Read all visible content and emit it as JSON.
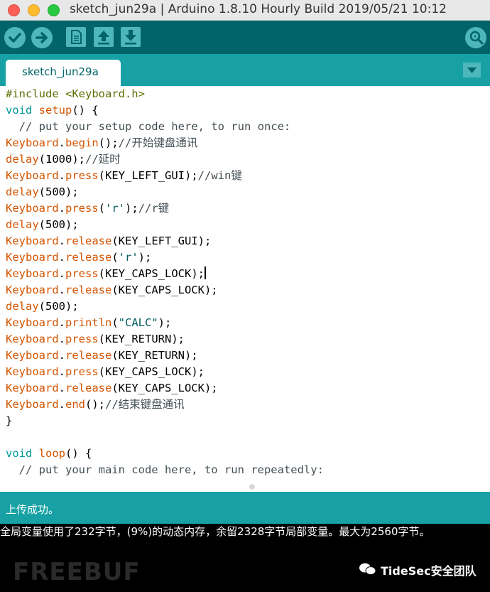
{
  "window": {
    "title": "sketch_jun29a | Arduino 1.8.10 Hourly Build 2019/05/21 10:12"
  },
  "toolbar": {
    "icons": [
      "verify-icon",
      "upload-icon",
      "new-icon",
      "open-icon",
      "save-icon",
      "serial-monitor-icon"
    ]
  },
  "tabs": [
    {
      "label": "sketch_jun29a"
    }
  ],
  "editor": {
    "lines": [
      "#include <Keyboard.h>",
      "void setup() {",
      "  // put your setup code here, to run once:",
      "Keyboard.begin();//开始键盘通讯",
      "delay(1000);//延时",
      "Keyboard.press(KEY_LEFT_GUI);//win键",
      "delay(500);",
      "Keyboard.press('r');//r键",
      "delay(500);",
      "Keyboard.release(KEY_LEFT_GUI);",
      "Keyboard.release('r');",
      "Keyboard.press(KEY_CAPS_LOCK);",
      "Keyboard.release(KEY_CAPS_LOCK);",
      "delay(500);",
      "Keyboard.println(\"CALC\");",
      "Keyboard.press(KEY_RETURN);",
      "Keyboard.release(KEY_RETURN);",
      "Keyboard.press(KEY_CAPS_LOCK);",
      "Keyboard.release(KEY_CAPS_LOCK);",
      "Keyboard.end();//结束键盘通讯",
      "}",
      "",
      "void loop() {",
      "  // put your main code here, to run repeatedly:"
    ]
  },
  "status": {
    "message": "上传成功。"
  },
  "console": {
    "line": "全局变量使用了232字节，(9%)的动态内存，余留2328字节局部变量。最大为2560字节。"
  },
  "watermark": {
    "text": "FREEBUF"
  },
  "badge": {
    "text": "TideSec安全团队"
  },
  "colors": {
    "toolbar": "#006468",
    "tabbar": "#17a1a5",
    "button": "#4db7bb",
    "keyword": "#d35400",
    "builtin": "#00979c"
  }
}
